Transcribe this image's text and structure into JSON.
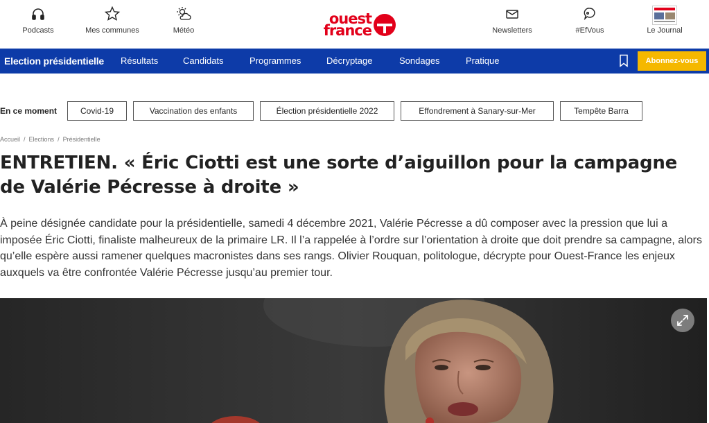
{
  "header": {
    "podcasts_label": "Podcasts",
    "communes_label": "Mes communes",
    "meteo_label": "Météo",
    "logo_line1": "ouest",
    "logo_line2": "france",
    "newsletters_label": "Newsletters",
    "efvous_label": "#EfVous",
    "journal_label": "Le Journal"
  },
  "nav": {
    "section_title": "Election présidentielle",
    "links": [
      "Résultats",
      "Candidats",
      "Programmes",
      "Décryptage",
      "Sondages",
      "Pratique"
    ],
    "subscribe_label": "Abonnez-vous"
  },
  "moment": {
    "label": "En ce moment",
    "chips": [
      "Covid-19",
      "Vaccination des enfants",
      "Élection présidentielle 2022",
      "Effondrement à Sanary-sur-Mer",
      "Tempête Barra"
    ]
  },
  "breadcrumb": [
    "Accueil",
    "Elections",
    "Présidentielle"
  ],
  "article": {
    "headline": "ENTRETIEN. « Éric Ciotti est une sorte d’aiguillon pour la campagne de Valérie Pécresse à droite »",
    "lead": "À peine désignée candidate pour la présidentielle, samedi 4 décembre 2021, Valérie Pécresse a dû composer avec la pression que lui a imposée Éric Ciotti, finaliste malheureux de la primaire LR. Il l’a rappelée à l’ordre sur l’orientation à droite que doit prendre sa campagne, alors qu’elle espère aussi ramener quelques macronistes dans ses rangs. Olivier Rouquan, politologue, décrypte pour Ouest-France les enjeux auxquels va être confrontée Valérie Pécresse jusqu’au premier tour."
  },
  "colors": {
    "brand_red": "#e2001a",
    "nav_blue": "#0d3ba8",
    "subscribe_yellow": "#f5b800"
  }
}
